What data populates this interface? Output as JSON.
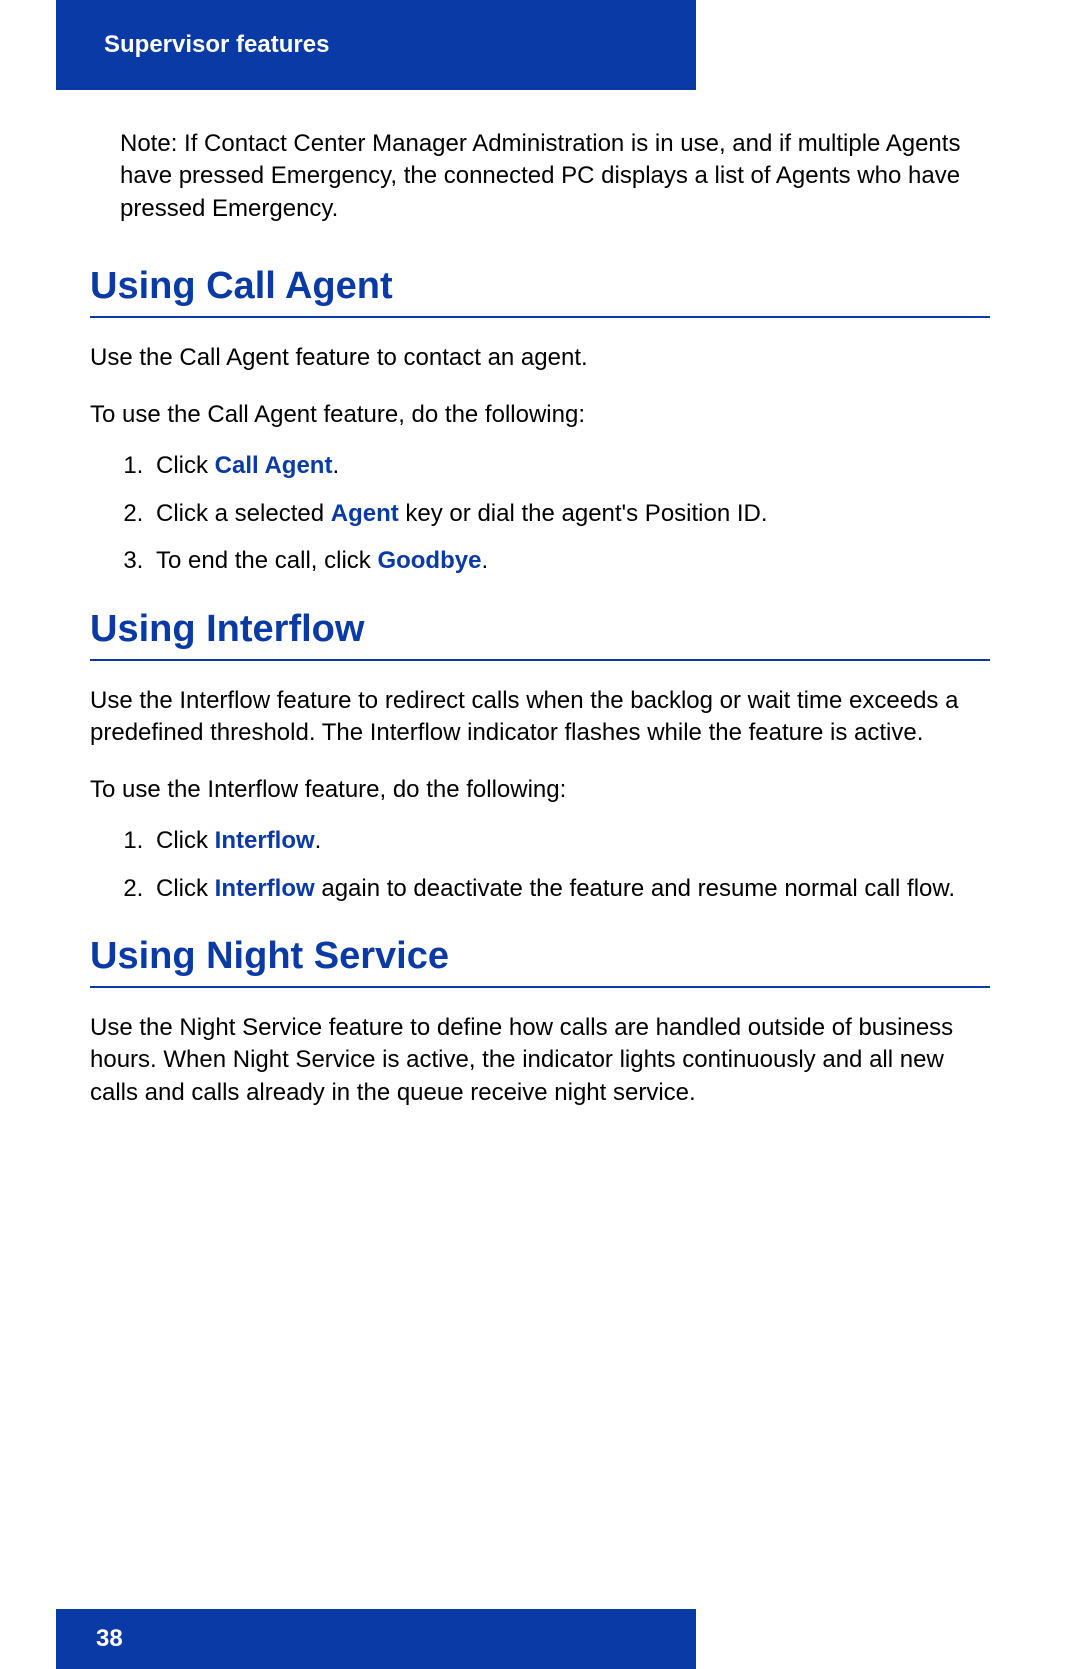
{
  "header": {
    "title": "Supervisor features"
  },
  "footer": {
    "page_number": "38"
  },
  "note": {
    "prefix": "Note:",
    "text": "If Contact Center Manager Administration is in use, and if multiple Agents have pressed Emergency, the connected PC displays a list of Agents who have pressed Emergency."
  },
  "sections": {
    "call_agent": {
      "heading": "Using Call Agent",
      "intro": "Use the Call Agent feature to contact an agent.",
      "lead": "To use the Call Agent feature, do the following:",
      "steps": {
        "s1_a": "Click ",
        "s1_kw": "Call Agent",
        "s1_b": ".",
        "s2_a": "Click a selected ",
        "s2_kw": "Agent",
        "s2_b": " key or dial the agent's Position ID.",
        "s3_a": "To end the call, click ",
        "s3_kw": "Goodbye",
        "s3_b": "."
      }
    },
    "interflow": {
      "heading": "Using Interflow",
      "intro": "Use the Interflow feature to redirect calls when the backlog or wait time exceeds a predefined threshold. The Interflow indicator flashes while the feature is active.",
      "lead": "To use the Interflow feature, do the following:",
      "steps": {
        "s1_a": "Click ",
        "s1_kw": "Interflow",
        "s1_b": ".",
        "s2_a": "Click ",
        "s2_kw": "Interflow",
        "s2_b": " again to deactivate the feature and resume normal call flow."
      }
    },
    "night": {
      "heading": "Using Night Service",
      "intro": "Use the Night Service feature to define how calls are handled outside of business hours. When Night Service is active, the indicator lights continuously and all new calls and calls already in the queue receive night service."
    }
  }
}
